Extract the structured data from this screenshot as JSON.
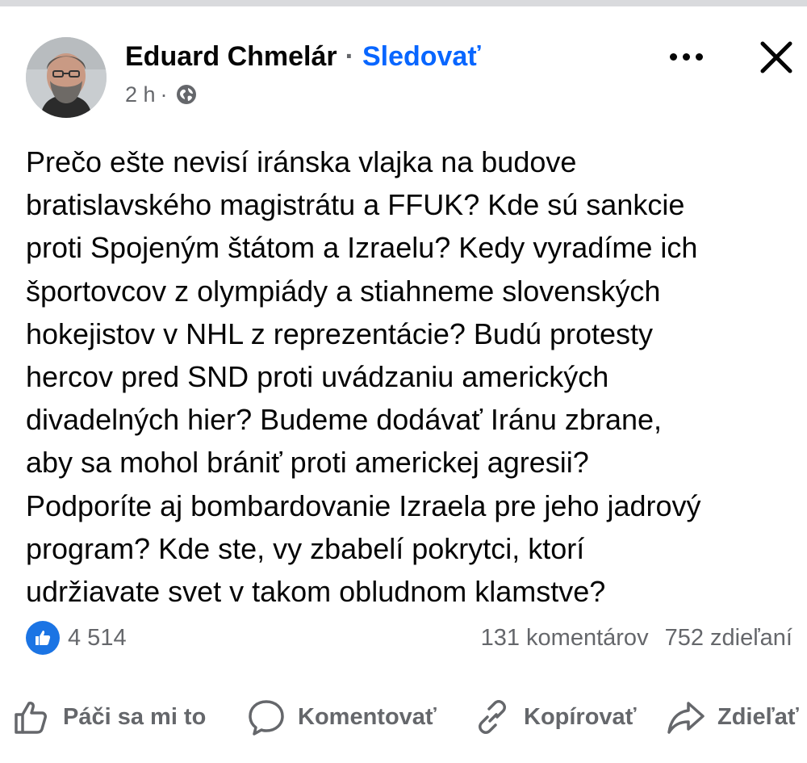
{
  "post": {
    "author": "Eduard Chmelár",
    "separator": "·",
    "follow_label": "Sledovať",
    "time": "2 h",
    "time_separator": "·",
    "privacy_icon": "globe-icon",
    "more_icon": "more-options-icon",
    "close_icon": "close-icon",
    "text_lines": [
      "Prečo ešte nevisí iránska vlajka na budove",
      "bratislavského magistrátu a FFUK? Kde sú sankcie",
      "proti Spojeným štátom a Izraelu? Kedy vyradíme ich",
      "športovcov z olympiády a stiahneme slovenských",
      "hokejistov v NHL z reprezentácie? Budú protesty",
      "hercov pred SND proti uvádzaniu amerických",
      "divadelných hier? Budeme dodávať Iránu zbrane,",
      "aby sa mohol brániť proti americkej agresii?",
      "Podporíte aj bombardovanie Izraela pre jeho jadrový",
      "program? Kde ste, vy zbabelí pokrytci, ktorí",
      "udržiavate svet v takom obludnom klamstve?"
    ]
  },
  "engagement": {
    "reaction_icon": "like-reaction-icon",
    "reaction_count": "4 514",
    "comments": "131 komentárov",
    "shares": "752 zdieľaní"
  },
  "actions": {
    "like": "Páči sa mi to",
    "comment": "Komentovať",
    "copy": "Kopírovať",
    "share": "Zdieľať"
  },
  "colors": {
    "accent": "#0866ff",
    "secondary_text": "#65676b",
    "reaction_blue": "#1b74e4",
    "top_strip": "#d9dadd"
  }
}
